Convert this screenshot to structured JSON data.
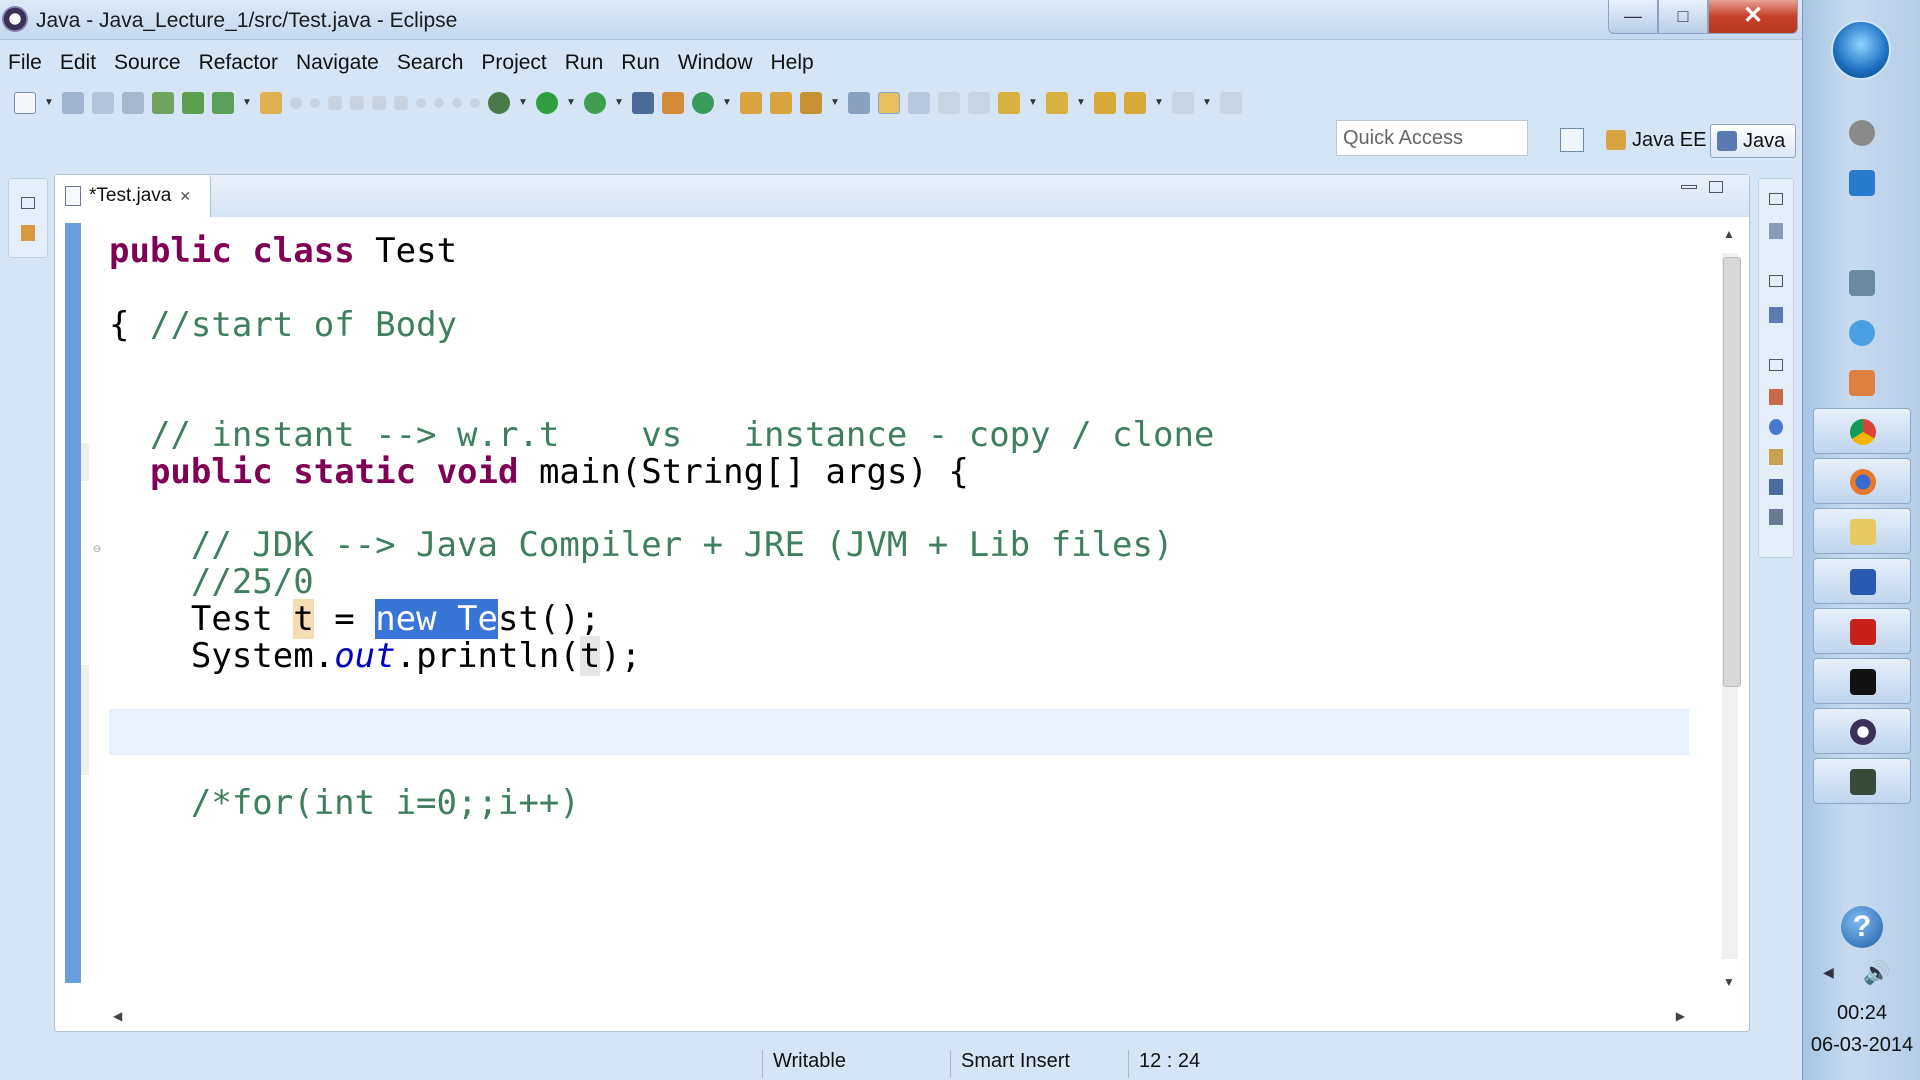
{
  "window": {
    "title": "Java - Java_Lecture_1/src/Test.java - Eclipse",
    "min_glyph": "—",
    "max_glyph": "□",
    "close_glyph": "✕"
  },
  "menu": [
    "File",
    "Edit",
    "Source",
    "Refactor",
    "Navigate",
    "Search",
    "Project",
    "Run",
    "Run",
    "Window",
    "Help"
  ],
  "toolbar": {
    "quick_access_placeholder": "Quick Access",
    "perspectives": [
      {
        "label": "Java EE",
        "active": false
      },
      {
        "label": "Java",
        "active": true
      }
    ]
  },
  "editor": {
    "tab_label": "*Test.java",
    "tab_close_glyph": "✕",
    "code": {
      "l1": {
        "kw1": "public",
        "kw2": "class",
        "name": "Test"
      },
      "l2": {
        "brace": "{",
        "comment": "//start of Body"
      },
      "l3": {
        "comment": "// instant --> w.r.t    vs   instance - copy / clone"
      },
      "l4": {
        "kw1": "public",
        "kw2": "static",
        "kw3": "void",
        "rest": "main(String[] args) {"
      },
      "l5": {
        "comment": "// JDK --> Java Compiler + JRE (JVM + Lib files)"
      },
      "l6": {
        "comment": "//25/0"
      },
      "l7": {
        "type": "Test",
        "var": "t",
        "eq": "=",
        "selected": "new Te",
        "rest": "st();"
      },
      "l8": {
        "pre": "System.",
        "field": "out",
        "mid": ".println(",
        "var": "t",
        "post": ");"
      },
      "l9": {
        "comment": "/*for(int i=0;;i++)"
      }
    }
  },
  "status": {
    "writable": "Writable",
    "insert_mode": "Smart Insert",
    "position": "12 : 24"
  },
  "taskbar": {
    "time": "00:24",
    "date": "06-03-2014",
    "help_glyph": "?"
  },
  "colors": {
    "keyword": "#7f0055",
    "comment": "#3f7f5f",
    "static_field": "#0000c0",
    "selection": "#3875d7",
    "ruler": "#6a9dde"
  }
}
